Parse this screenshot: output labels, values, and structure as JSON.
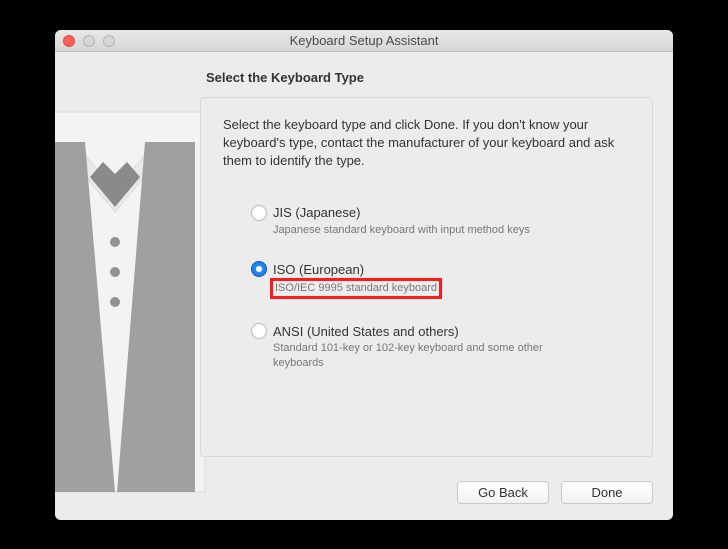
{
  "window": {
    "title": "Keyboard Setup Assistant"
  },
  "heading": "Select the Keyboard Type",
  "instructions": "Select the keyboard type and click Done. If you don't know your keyboard's type, contact the manufacturer of your keyboard and ask them to identify the type.",
  "options": {
    "jis": {
      "label": "JIS (Japanese)",
      "desc": "Japanese standard keyboard with input method keys",
      "selected": false
    },
    "iso": {
      "label": "ISO (European)",
      "desc": "ISO/IEC 9995 standard keyboard",
      "selected": true
    },
    "ansi": {
      "label": "ANSI (United States and others)",
      "desc": "Standard 101-key or 102-key keyboard and some other keyboards",
      "selected": false
    }
  },
  "buttons": {
    "goback": "Go Back",
    "done": "Done"
  }
}
